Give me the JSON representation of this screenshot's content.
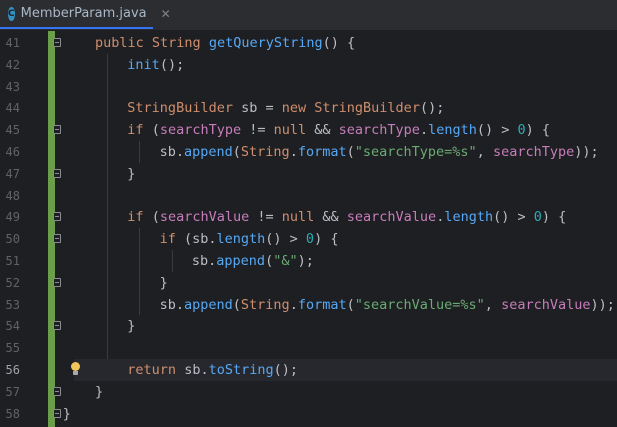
{
  "tab": {
    "icon_letter": "C",
    "title": "MemberParam.java",
    "close_symbol": "✕"
  },
  "colors": {
    "keyword": "#cf8e6d",
    "method": "#56a8f5",
    "field": "#c77dbb",
    "string": "#6aab73",
    "number": "#2aacb8",
    "plain": "#bcbec4",
    "change_bar": "#6b9e49"
  },
  "lines": [
    {
      "num": "41",
      "tokens": [
        [
          "kw",
          "public"
        ],
        [
          "pl",
          " "
        ],
        [
          "kw",
          "String"
        ],
        [
          "pl",
          " "
        ],
        [
          "fn",
          "getQueryString"
        ],
        [
          "pl",
          "() {"
        ]
      ]
    },
    {
      "num": "42",
      "tokens": [
        [
          "fn",
          "init"
        ],
        [
          "pl",
          "();"
        ]
      ]
    },
    {
      "num": "43",
      "tokens": []
    },
    {
      "num": "44",
      "tokens": [
        [
          "kw",
          "StringBuilder"
        ],
        [
          "pl",
          " sb = "
        ],
        [
          "kw",
          "new"
        ],
        [
          "pl",
          " "
        ],
        [
          "kw",
          "StringBuilder"
        ],
        [
          "pl",
          "();"
        ]
      ]
    },
    {
      "num": "45",
      "tokens": [
        [
          "kw",
          "if"
        ],
        [
          "pl",
          " ("
        ],
        [
          "fld",
          "searchType"
        ],
        [
          "pl",
          " != "
        ],
        [
          "kw",
          "null"
        ],
        [
          "pl",
          " && "
        ],
        [
          "fld",
          "searchType"
        ],
        [
          "pl",
          "."
        ],
        [
          "fn",
          "length"
        ],
        [
          "pl",
          "() > "
        ],
        [
          "num",
          "0"
        ],
        [
          "pl",
          ") {"
        ]
      ]
    },
    {
      "num": "46",
      "tokens": [
        [
          "pl",
          "sb."
        ],
        [
          "fn",
          "append"
        ],
        [
          "pl",
          "("
        ],
        [
          "kw",
          "String"
        ],
        [
          "pl",
          "."
        ],
        [
          "fn",
          "format"
        ],
        [
          "pl",
          "("
        ],
        [
          "str",
          "\"searchType=%s\""
        ],
        [
          "pl",
          ", "
        ],
        [
          "fld",
          "searchType"
        ],
        [
          "pl",
          "));"
        ]
      ]
    },
    {
      "num": "47",
      "tokens": [
        [
          "pl",
          "}"
        ]
      ]
    },
    {
      "num": "48",
      "tokens": []
    },
    {
      "num": "49",
      "tokens": [
        [
          "kw",
          "if"
        ],
        [
          "pl",
          " ("
        ],
        [
          "fld",
          "searchValue"
        ],
        [
          "pl",
          " != "
        ],
        [
          "kw",
          "null"
        ],
        [
          "pl",
          " && "
        ],
        [
          "fld",
          "searchValue"
        ],
        [
          "pl",
          "."
        ],
        [
          "fn",
          "length"
        ],
        [
          "pl",
          "() > "
        ],
        [
          "num",
          "0"
        ],
        [
          "pl",
          ") {"
        ]
      ]
    },
    {
      "num": "50",
      "tokens": [
        [
          "kw",
          "if"
        ],
        [
          "pl",
          " (sb."
        ],
        [
          "fn",
          "length"
        ],
        [
          "pl",
          "() > "
        ],
        [
          "num",
          "0"
        ],
        [
          "pl",
          ") {"
        ]
      ]
    },
    {
      "num": "51",
      "tokens": [
        [
          "pl",
          "sb."
        ],
        [
          "fn",
          "append"
        ],
        [
          "pl",
          "("
        ],
        [
          "str",
          "\"&\""
        ],
        [
          "pl",
          ");"
        ]
      ]
    },
    {
      "num": "52",
      "tokens": [
        [
          "pl",
          "}"
        ]
      ]
    },
    {
      "num": "53",
      "tokens": [
        [
          "pl",
          "sb."
        ],
        [
          "fn",
          "append"
        ],
        [
          "pl",
          "("
        ],
        [
          "kw",
          "String"
        ],
        [
          "pl",
          "."
        ],
        [
          "fn",
          "format"
        ],
        [
          "pl",
          "("
        ],
        [
          "str",
          "\"searchValue=%s\""
        ],
        [
          "pl",
          ", "
        ],
        [
          "fld",
          "searchValue"
        ],
        [
          "pl",
          "));"
        ]
      ]
    },
    {
      "num": "54",
      "tokens": [
        [
          "pl",
          "}"
        ]
      ]
    },
    {
      "num": "55",
      "tokens": []
    },
    {
      "num": "56",
      "tokens": [
        [
          "kw",
          "return"
        ],
        [
          "pl",
          " sb."
        ],
        [
          "fn",
          "toString"
        ],
        [
          "pl",
          "();"
        ]
      ]
    },
    {
      "num": "57",
      "tokens": [
        [
          "pl",
          "}"
        ]
      ]
    },
    {
      "num": "58",
      "tokens": [
        [
          "pl",
          "}"
        ]
      ]
    }
  ]
}
